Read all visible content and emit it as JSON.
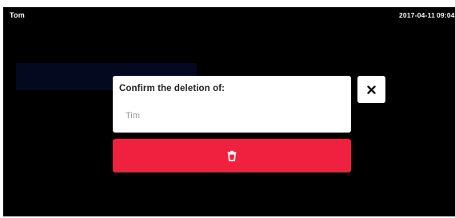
{
  "status_bar": {
    "user_name": "Tom",
    "date": "2017-04-11",
    "time": "09:04"
  },
  "dialog": {
    "title": "Confirm the deletion of:",
    "item_name": "Tim",
    "close_icon": "close-icon",
    "delete_icon": "trash-icon"
  },
  "colors": {
    "screen_background": "#000000",
    "card_background": "#ffffff",
    "delete_accent": "#f0203f",
    "muted_text": "#9a9a9a"
  }
}
